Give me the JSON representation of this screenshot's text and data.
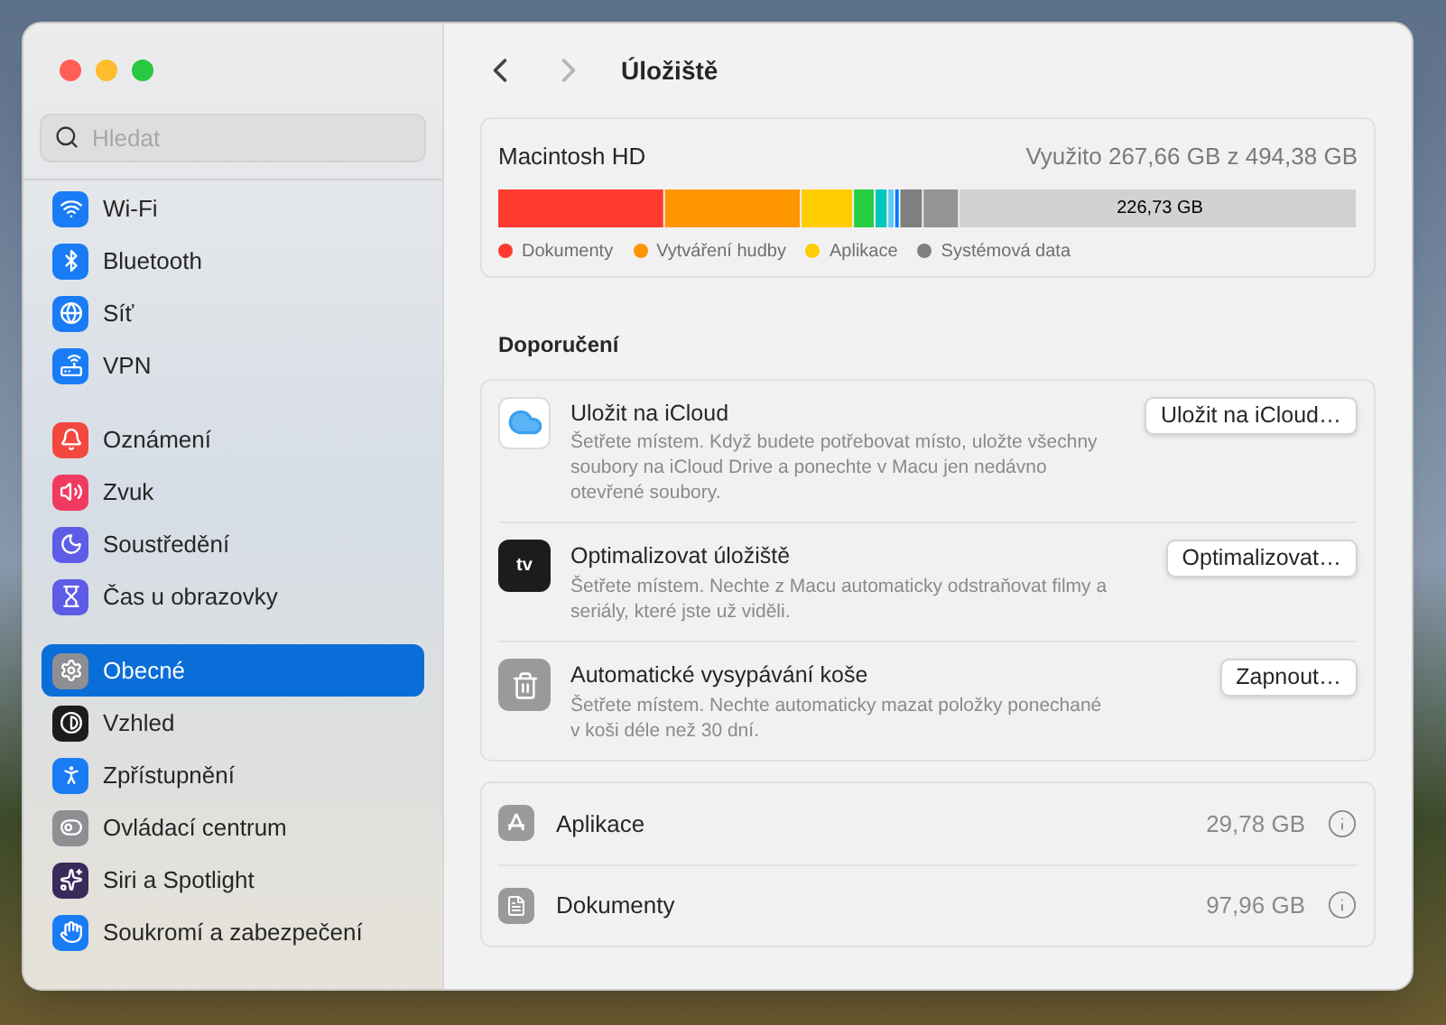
{
  "window": {
    "title": "Úložiště",
    "controls": [
      {
        "color": "#ff5f57"
      },
      {
        "color": "#febc2e"
      },
      {
        "color": "#28c840"
      }
    ]
  },
  "search": {
    "placeholder": "Hledat"
  },
  "sidebar": {
    "groups": [
      [
        {
          "label": "Wi-Fi",
          "kind": "wifi",
          "color": "#1a7cf5",
          "selected": false
        },
        {
          "label": "Bluetooth",
          "kind": "bluetooth",
          "color": "#1a7cf5",
          "selected": false
        },
        {
          "label": "Síť",
          "kind": "globe",
          "color": "#1a7cf5",
          "selected": false
        },
        {
          "label": "VPN",
          "kind": "vpn",
          "color": "#1a7cf5",
          "selected": false
        }
      ],
      [
        {
          "label": "Oznámení",
          "kind": "bell",
          "color": "#f2483f",
          "selected": false
        },
        {
          "label": "Zvuk",
          "kind": "sound",
          "color": "#f03a5f",
          "selected": false
        },
        {
          "label": "Soustředění",
          "kind": "moon",
          "color": "#5e5ce6",
          "selected": false
        },
        {
          "label": "Čas u obrazovky",
          "kind": "hourglass",
          "color": "#5e5ce6",
          "selected": false
        }
      ],
      [
        {
          "label": "Obecné",
          "kind": "gear",
          "color": "#8e8e93",
          "selected": true
        },
        {
          "label": "Vzhled",
          "kind": "appearance",
          "color": "#1c1c1e",
          "selected": false
        },
        {
          "label": "Zpřístupnění",
          "kind": "accessibility",
          "color": "#1a7cf5",
          "selected": false
        },
        {
          "label": "Ovládací centrum",
          "kind": "toggles",
          "color": "#8e8e93",
          "selected": false
        },
        {
          "label": "Siri a Spotlight",
          "kind": "siri",
          "color": "#3a2a5a",
          "selected": false
        },
        {
          "label": "Soukromí a zabezpečení",
          "kind": "hand",
          "color": "#1a7cf5",
          "selected": false
        }
      ]
    ]
  },
  "disk": {
    "name": "Macintosh HD",
    "usage": "Využito 267,66 GB z 494,38 GB",
    "free": {
      "label": "226,73 GB"
    },
    "legend": [
      {
        "label": "Dokumenty",
        "color": "#ff3b30"
      },
      {
        "label": "Vytváření hudby",
        "color": "#ff9500"
      },
      {
        "label": "Aplikace",
        "color": "#ffcc00"
      },
      {
        "label": "Systémová data",
        "color": "#7f7f7f"
      }
    ]
  },
  "recommendations": {
    "heading": "Doporučení",
    "items": [
      {
        "kind": "icloud",
        "title": "Uložit na iCloud",
        "description": "Šetřete místem. Když budete potřebovat místo, uložte všechny soubory na iCloud Drive a ponechte v Macu jen nedávno otevřené soubory.",
        "button": "Uložit na iCloud…"
      },
      {
        "kind": "tv",
        "title": "Optimalizovat úložiště",
        "description": "Šetřete místem. Nechte z Macu automaticky odstraňovat filmy a seriály, které jste už viděli.",
        "button": "Optimalizovat…",
        "icon_text": "tv"
      },
      {
        "kind": "trash",
        "title": "Automatické vysypávání koše",
        "description": "Šetřete místem. Nechte automaticky mazat položky ponechané v koši déle než 30 dní.",
        "button": "Zapnout…"
      }
    ]
  },
  "categories": [
    {
      "kind": "apps",
      "label": "Aplikace",
      "size": "29,78 GB"
    },
    {
      "kind": "documents",
      "label": "Dokumenty",
      "size": "97,96 GB"
    }
  ]
}
